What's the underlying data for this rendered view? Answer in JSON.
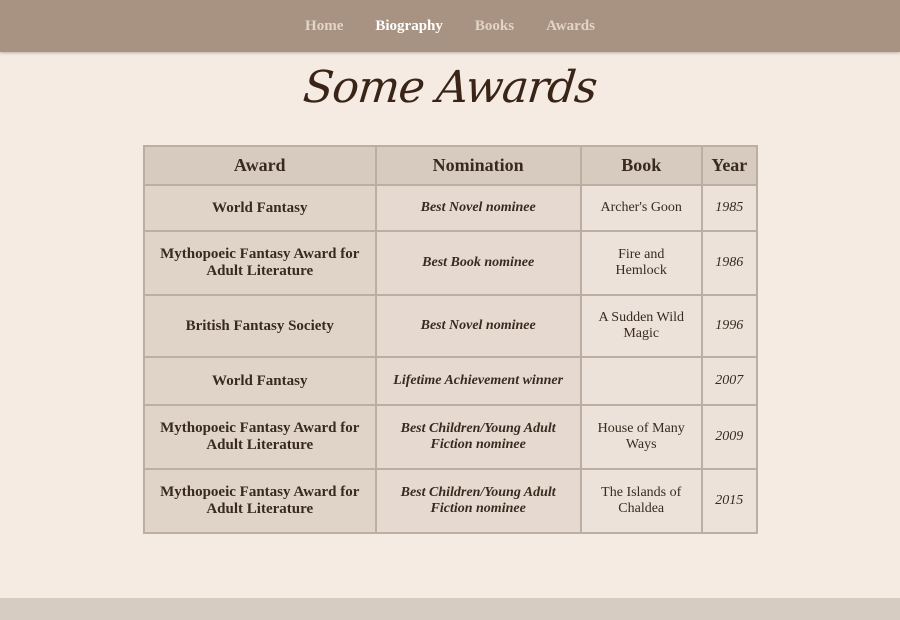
{
  "nav": {
    "items": [
      {
        "label": "Home",
        "active": false
      },
      {
        "label": "Biography",
        "active": true
      },
      {
        "label": "Books",
        "active": false
      },
      {
        "label": "Awards",
        "active": false
      }
    ]
  },
  "page": {
    "title": "Some Awards"
  },
  "table": {
    "headers": {
      "award": "Award",
      "nomination": "Nomination",
      "book": "Book",
      "year": "Year"
    },
    "rows": [
      {
        "award": "World Fantasy",
        "nomination": "Best Novel nominee",
        "book": "Archer's Goon",
        "year": "1985"
      },
      {
        "award": "Mythopoeic Fantasy Award for Adult Literature",
        "nomination": "Best Book nominee",
        "book": "Fire and Hemlock",
        "year": "1986"
      },
      {
        "award": "British Fantasy Society",
        "nomination": "Best Novel nominee",
        "book": "A Sudden Wild Magic",
        "year": "1996"
      },
      {
        "award": "World Fantasy",
        "nomination": "Lifetime Achievement winner",
        "book": "",
        "year": "2007"
      },
      {
        "award": "Mythopoeic Fantasy Award for Adult Literature",
        "nomination": "Best Children/Young Adult Fiction nominee",
        "book": "House of Many Ways",
        "year": "2009"
      },
      {
        "award": "Mythopoeic Fantasy Award for Adult Literature",
        "nomination": "Best Children/Young Adult Fiction nominee",
        "book": "The Islands of Chaldea",
        "year": "2015"
      }
    ]
  },
  "colors": {
    "background": "#f5ebe2",
    "navbar": "#a89383",
    "nav_active": "#ffffff",
    "nav_inactive": "#e2d5c8",
    "header_cell": "#d7cbc0",
    "body_cell": "#e9ddd3",
    "text": "#3a2a1e"
  }
}
